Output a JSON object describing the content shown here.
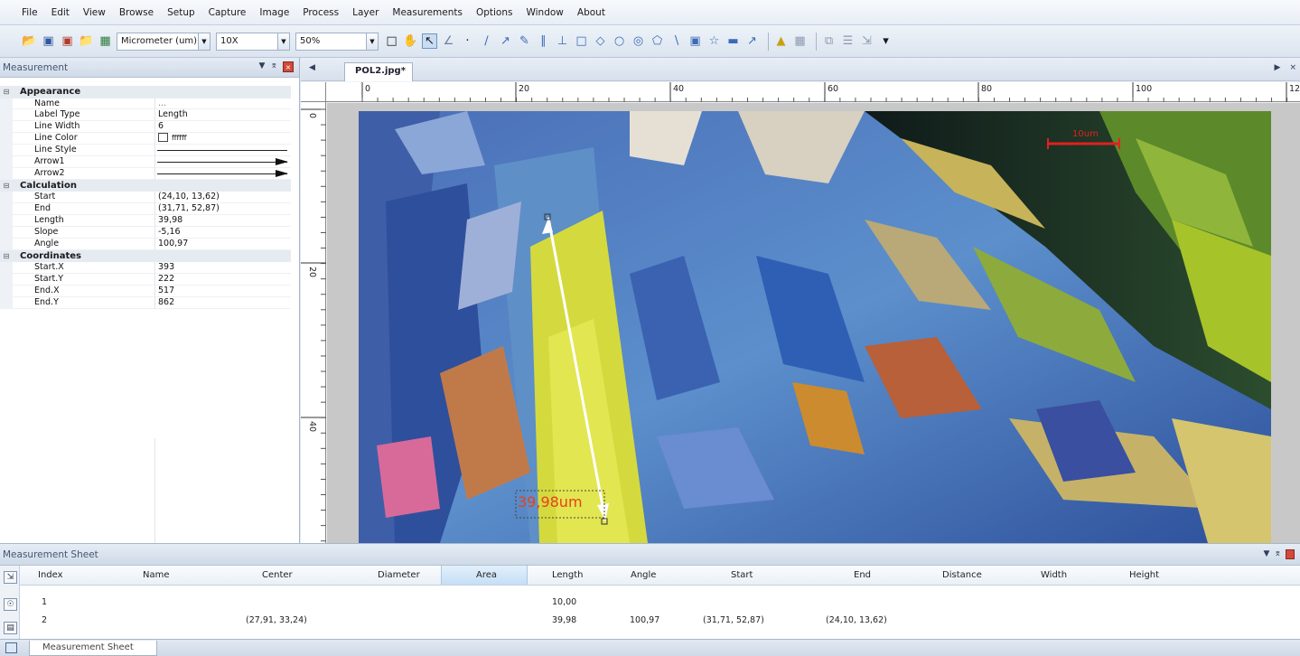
{
  "menu": [
    "File",
    "Edit",
    "View",
    "Browse",
    "Setup",
    "Capture",
    "Image",
    "Process",
    "Layer",
    "Measurements",
    "Options",
    "Window",
    "About"
  ],
  "toolbar": {
    "unit_select": "Micrometer (um)",
    "objective_select": "10X",
    "zoom_select": "50%"
  },
  "panel": {
    "title": "Measurement",
    "categories": {
      "appearance": "Appearance",
      "calculation": "Calculation",
      "coordinates": "Coordinates"
    },
    "appearance": {
      "name_label": "Name",
      "name_value": "...",
      "label_type_label": "Label Type",
      "label_type_value": "Length",
      "line_width_label": "Line Width",
      "line_width_value": "6",
      "line_color_label": "Line Color",
      "line_color_value": "ffffff",
      "line_style_label": "Line Style",
      "arrow1_label": "Arrow1",
      "arrow2_label": "Arrow2"
    },
    "calculation": {
      "start_label": "Start",
      "start_value": "(24,10, 13,62)",
      "end_label": "End",
      "end_value": "(31,71, 52,87)",
      "length_label": "Length",
      "length_value": "39,98",
      "slope_label": "Slope",
      "slope_value": "-5,16",
      "angle_label": "Angle",
      "angle_value": "100,97"
    },
    "coordinates": {
      "startx_label": "Start.X",
      "startx_value": "393",
      "starty_label": "Start.Y",
      "starty_value": "222",
      "endx_label": "End.X",
      "endx_value": "517",
      "endy_label": "End.Y",
      "endy_value": "862"
    }
  },
  "document": {
    "tab_title": "POL2.jpg*",
    "ruler_h": [
      "0",
      "20",
      "40",
      "60",
      "80",
      "100",
      "12"
    ],
    "ruler_v": [
      "0",
      "20",
      "40"
    ],
    "measurement_label": "39,98um",
    "scalebar_label": "10um",
    "colors": {
      "measurement_label": "#e8401c",
      "scalebar": "#e02020",
      "measure_line": "#ffffff"
    }
  },
  "sheet": {
    "title": "Measurement Sheet",
    "columns": [
      "Index",
      "Name",
      "Center",
      "Diameter",
      "Area",
      "Length",
      "Angle",
      "Start",
      "End",
      "Distance",
      "Width",
      "Height"
    ],
    "rows": [
      {
        "index": "1",
        "name": "",
        "center": "",
        "length": "10,00",
        "angle": "",
        "start": "",
        "end": ""
      },
      {
        "index": "2",
        "name": "",
        "center": "(27,91, 33,24)",
        "length": "39,98",
        "angle": "100,97",
        "start": "(31,71, 52,87)",
        "end": "(24,10, 13,62)"
      }
    ]
  },
  "status_tab": "Measurement Sheet"
}
